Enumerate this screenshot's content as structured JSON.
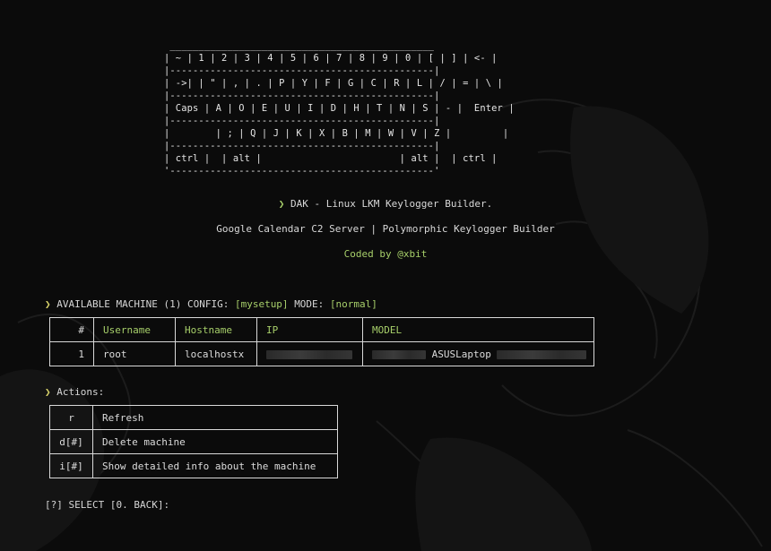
{
  "keyboard_art": " ______________________________________________\n| ~ | 1 | 2 | 3 | 4 | 5 | 6 | 7 | 8 | 9 | 0 | [ | ] | <- |\n|----------------------------------------------|\n| ->| | \" | , | . | P | Y | F | G | C | R | L | / | = | \\ |\n|----------------------------------------------|\n| Caps | A | O | E | U | I | D | H | T | N | S | - |  Enter |\n|----------------------------------------------|\n|        | ; | Q | J | K | X | B | M | W | V | Z |         |\n|----------------------------------------------|\n| ctrl |  | alt |                        | alt |  | ctrl |\n'----------------------------------------------'",
  "header": {
    "chevron": "❯",
    "title": "DAK - Linux LKM Keylogger Builder.",
    "subtitle": "Google Calendar C2 Server | Polymorphic Keylogger Builder",
    "coded_by": "Coded by @xbit"
  },
  "machines_prompt": {
    "chevron": "❯",
    "label": "AVAILABLE MACHINE",
    "count": "(1)",
    "config_label": "CONFIG:",
    "config_value": "[mysetup]",
    "mode_label": "MODE:",
    "mode_value": "[normal]"
  },
  "machines_table": {
    "columns": [
      "#",
      "Username",
      "Hostname",
      "IP",
      "MODEL"
    ],
    "rows": [
      {
        "num": "1",
        "username": "root",
        "hostname": "localhostx",
        "ip": "",
        "model": "ASUSLaptop"
      }
    ]
  },
  "actions_prompt": {
    "chevron": "❯",
    "label": "Actions:"
  },
  "actions_table": {
    "rows": [
      {
        "key": "r",
        "label": "Refresh"
      },
      {
        "key": "d[#]",
        "label": "Delete machine"
      },
      {
        "key": "i[#]",
        "label": "Show detailed info about the machine"
      }
    ]
  },
  "select_prompt": {
    "text": "[?] SELECT [0. BACK]:"
  },
  "colors": {
    "background": "#0b0b0b",
    "accent_green": "#a7cf6a",
    "chevron_yellow": "#d9d36a",
    "text": "#d6d6d6"
  }
}
